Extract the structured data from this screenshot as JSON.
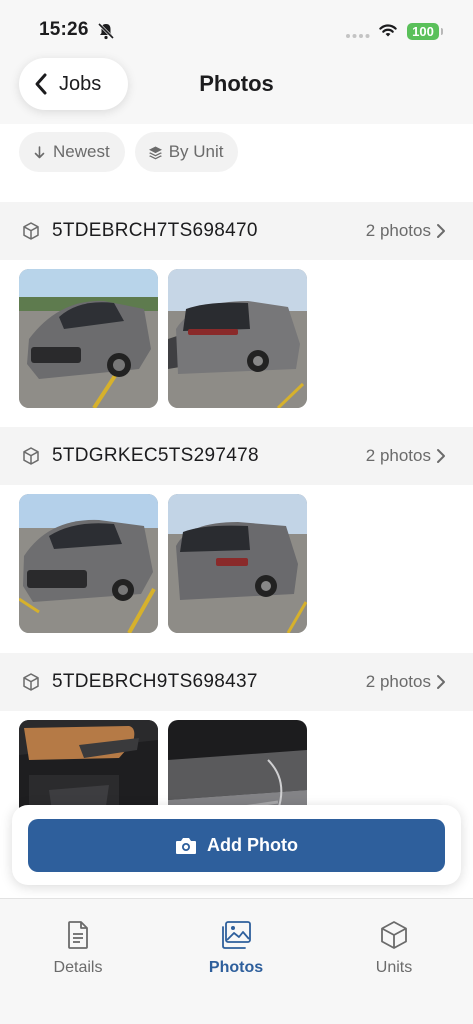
{
  "status_bar": {
    "time": "15:26",
    "battery": "100"
  },
  "nav": {
    "back_label": "Jobs",
    "title": "Photos"
  },
  "filters": [
    {
      "label": "Newest",
      "icon": "arrow-down-icon"
    },
    {
      "label": "By Unit",
      "icon": "layers-icon"
    }
  ],
  "groups": [
    {
      "vin": "5TDEBRCH7TS698470",
      "count": "2 photos",
      "photos": [
        "silver SUV front three-quarter view",
        "silver SUV rear view"
      ]
    },
    {
      "vin": "5TDGRKEC5TS297478",
      "count": "2 photos",
      "photos": [
        "gray minivan front view",
        "gray minivan rear view"
      ]
    },
    {
      "vin": "5TDEBRCH9TS698437",
      "count": "2 photos",
      "photos": [
        "door panel interior",
        "interior trim close-up"
      ]
    }
  ],
  "add_photo": {
    "label": "Add Photo"
  },
  "tabs": [
    {
      "label": "Details",
      "icon": "document-icon",
      "active": false
    },
    {
      "label": "Photos",
      "icon": "photos-icon",
      "active": true
    },
    {
      "label": "Units",
      "icon": "cube-icon",
      "active": false
    }
  ],
  "colors": {
    "accent": "#2e5f9c",
    "battery": "#5ac05a"
  }
}
